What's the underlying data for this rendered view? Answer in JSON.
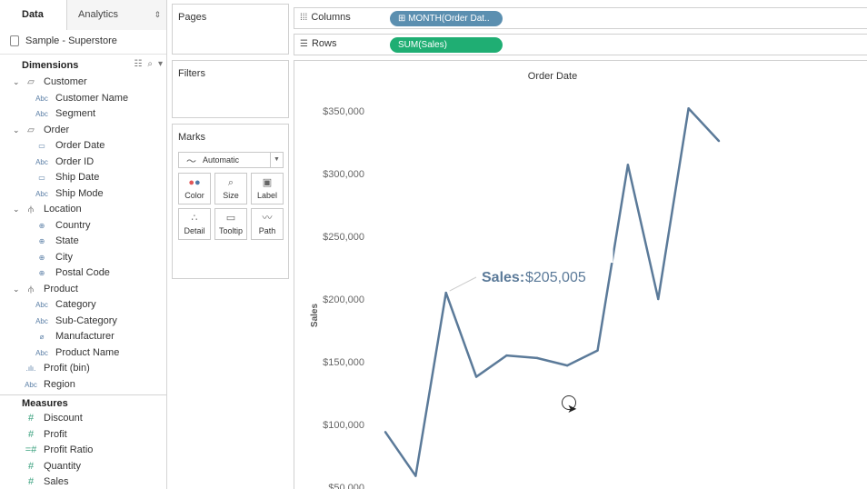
{
  "tabs": {
    "data": "Data",
    "analytics": "Analytics"
  },
  "datasource": "Sample - Superstore",
  "dimensions_title": "Dimensions",
  "dimensions": [
    {
      "kind": "folder",
      "label": "Customer",
      "icon": "folder-icon"
    },
    {
      "kind": "child",
      "label": "Customer Name",
      "icon": "abc-string-icon",
      "glyph": "Abc"
    },
    {
      "kind": "child",
      "label": "Segment",
      "icon": "abc-string-icon",
      "glyph": "Abc"
    },
    {
      "kind": "folder",
      "label": "Order",
      "icon": "folder-icon"
    },
    {
      "kind": "child",
      "label": "Order Date",
      "icon": "calendar-icon",
      "glyph": "▭"
    },
    {
      "kind": "child",
      "label": "Order ID",
      "icon": "abc-string-icon",
      "glyph": "Abc"
    },
    {
      "kind": "child",
      "label": "Ship Date",
      "icon": "calendar-icon",
      "glyph": "▭"
    },
    {
      "kind": "child",
      "label": "Ship Mode",
      "icon": "abc-string-icon",
      "glyph": "Abc"
    },
    {
      "kind": "folder",
      "label": "Location",
      "icon": "hierarchy-icon"
    },
    {
      "kind": "child",
      "label": "Country",
      "icon": "globe-icon",
      "glyph": "⊕"
    },
    {
      "kind": "child",
      "label": "State",
      "icon": "globe-icon",
      "glyph": "⊕"
    },
    {
      "kind": "child",
      "label": "City",
      "icon": "globe-icon",
      "glyph": "⊕"
    },
    {
      "kind": "child",
      "label": "Postal Code",
      "icon": "globe-icon",
      "glyph": "⊕"
    },
    {
      "kind": "folder",
      "label": "Product",
      "icon": "hierarchy-icon"
    },
    {
      "kind": "child",
      "label": "Category",
      "icon": "abc-string-icon",
      "glyph": "Abc"
    },
    {
      "kind": "child",
      "label": "Sub-Category",
      "icon": "abc-string-icon",
      "glyph": "Abc"
    },
    {
      "kind": "child",
      "label": "Manufacturer",
      "icon": "paperclip-icon",
      "glyph": "⌀"
    },
    {
      "kind": "child",
      "label": "Product Name",
      "icon": "abc-string-icon",
      "glyph": "Abc"
    },
    {
      "kind": "top",
      "label": "Profit (bin)",
      "icon": "bin-histogram-icon",
      "glyph": ".ılı."
    },
    {
      "kind": "top",
      "label": "Region",
      "icon": "abc-string-icon",
      "glyph": "Abc"
    }
  ],
  "measures_title": "Measures",
  "measures": [
    {
      "label": "Discount",
      "icon": "number-icon",
      "glyph": "#"
    },
    {
      "label": "Profit",
      "icon": "number-icon",
      "glyph": "#"
    },
    {
      "label": "Profit Ratio",
      "icon": "calculated-number-icon",
      "glyph": "=#"
    },
    {
      "label": "Quantity",
      "icon": "number-icon",
      "glyph": "#"
    },
    {
      "label": "Sales",
      "icon": "number-icon",
      "glyph": "#"
    }
  ],
  "cards": {
    "pages": "Pages",
    "filters": "Filters",
    "marks": "Marks"
  },
  "marks": {
    "type": "Automatic",
    "buttons": [
      {
        "label": "Color",
        "icon": "color-dots-icon"
      },
      {
        "label": "Size",
        "icon": "size-icon"
      },
      {
        "label": "Label",
        "icon": "label-icon"
      },
      {
        "label": "Detail",
        "icon": "detail-icon"
      },
      {
        "label": "Tooltip",
        "icon": "tooltip-icon"
      },
      {
        "label": "Path",
        "icon": "path-icon"
      }
    ]
  },
  "shelves": {
    "columns_label": "Columns",
    "rows_label": "Rows",
    "columns_pill": "MONTH(Order Dat..",
    "rows_pill": "SUM(Sales)"
  },
  "colors": {
    "line": "#5b7a99",
    "columns_pill": "#5b8fb0",
    "rows_pill": "#1fae73"
  },
  "chart_data": {
    "type": "line",
    "title": "Order Date",
    "ylabel": "Sales",
    "y_ticks": [
      "$350,000",
      "$300,000",
      "$250,000",
      "$200,000",
      "$150,000",
      "$100,000",
      "$50,000"
    ],
    "ylim": [
      50000,
      350000
    ],
    "x": [
      1,
      2,
      3,
      4,
      5,
      6,
      7,
      8,
      9,
      10,
      11,
      12
    ],
    "values": [
      94000,
      59000,
      205005,
      138000,
      155000,
      153000,
      147000,
      159000,
      307000,
      200000,
      352000,
      326000
    ],
    "annotation": {
      "label": "Sales:",
      "value": "$205,005",
      "point_index": 2
    }
  }
}
